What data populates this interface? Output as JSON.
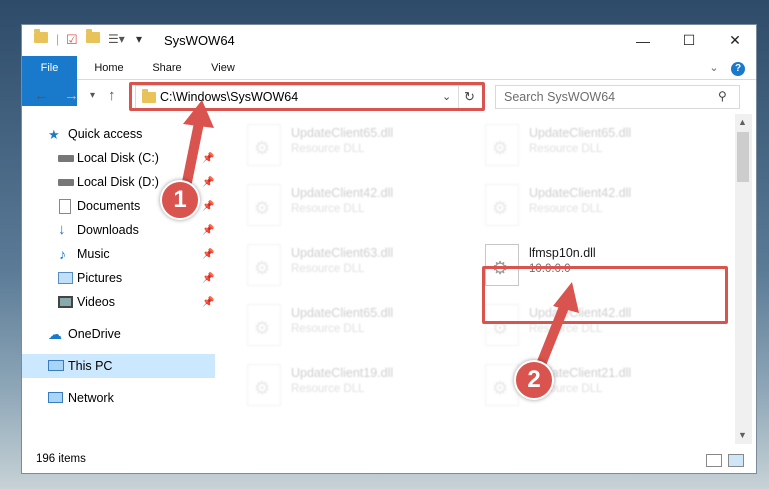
{
  "window": {
    "title": "SysWOW64",
    "controls": {
      "minimize": "—",
      "maximize": "☐",
      "close": "✕"
    }
  },
  "ribbon": {
    "tabs": [
      {
        "label": "File"
      },
      {
        "label": "Home"
      },
      {
        "label": "Share"
      },
      {
        "label": "View"
      }
    ],
    "expand_icon": "chevron-down-icon",
    "help_icon": "?"
  },
  "nav": {
    "address": "C:\\Windows\\SysWOW64",
    "search_placeholder": "Search SysWOW64"
  },
  "sidebar": {
    "items": [
      {
        "label": "Quick access",
        "icon": "star-icon"
      },
      {
        "label": "Local Disk (C:)",
        "icon": "drive-icon",
        "pinned": true
      },
      {
        "label": "Local Disk (D:)",
        "icon": "drive-icon",
        "pinned": true
      },
      {
        "label": "Documents",
        "icon": "document-icon",
        "pinned": true
      },
      {
        "label": "Downloads",
        "icon": "download-icon",
        "pinned": true
      },
      {
        "label": "Music",
        "icon": "music-icon",
        "pinned": true
      },
      {
        "label": "Pictures",
        "icon": "pictures-icon",
        "pinned": true
      },
      {
        "label": "Videos",
        "icon": "video-icon",
        "pinned": true
      },
      {
        "label": "OneDrive",
        "icon": "cloud-icon"
      },
      {
        "label": "This PC",
        "icon": "computer-icon",
        "selected": true
      },
      {
        "label": "Network",
        "icon": "network-icon"
      }
    ]
  },
  "files": {
    "background_items": [
      {
        "name": "UpdateClient65.dll",
        "desc": "Resource DLL"
      },
      {
        "name": "UpdateClient65.dll",
        "desc": "Resource DLL"
      },
      {
        "name": "UpdateClient42.dll",
        "desc": "Resource DLL"
      },
      {
        "name": "UpdateClient42.dll",
        "desc": "Resource DLL"
      },
      {
        "name": "UpdateClient63.dll",
        "desc": "Resource DLL"
      },
      {
        "name": "UpdateClient65.dll",
        "desc": "Resource DLL"
      },
      {
        "name": "UpdateClient42.dll",
        "desc": "Resource DLL"
      },
      {
        "name": "UpdateClient19.dll",
        "desc": "Resource DLL"
      },
      {
        "name": "UpdateClient21.dll",
        "desc": "Resource DLL"
      }
    ],
    "target": {
      "name": "lfmsp10n.dll",
      "version": "10.0.0.0"
    }
  },
  "status": {
    "item_count": "196 items"
  },
  "annotations": {
    "step1": "1",
    "step2": "2"
  },
  "colors": {
    "accent": "#1979ca",
    "highlight": "#d9534f",
    "selection": "#cce8ff"
  }
}
